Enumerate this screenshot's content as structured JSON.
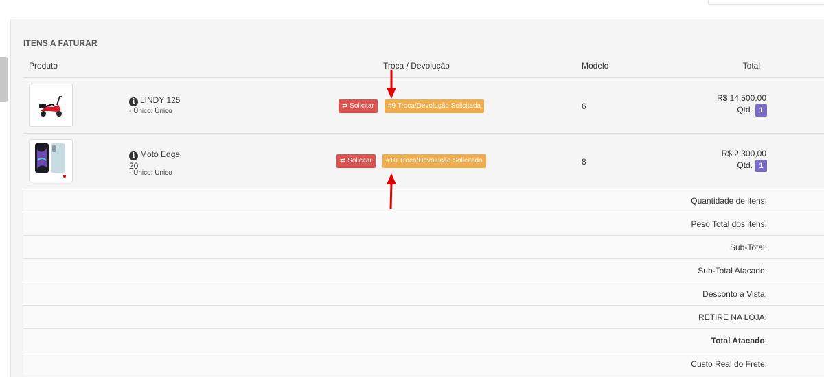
{
  "section": {
    "title": "ITENS A FATURAR"
  },
  "table": {
    "headers": {
      "produto": "Produto",
      "troca": "Troca / Devolução",
      "modelo": "Modelo",
      "total": "Total"
    },
    "rows": [
      {
        "name": "LINDY 125",
        "variant": "- Único: Único",
        "solicitar_label": "⇄ Solicitar",
        "troca_badge": "#9 Troca/Devolução Solicitada",
        "modelo": "6",
        "price": "R$ 14.500,00",
        "qtd_label": "Qtd.",
        "qtd": "1"
      },
      {
        "name_line1": "Moto Edge",
        "name_line2": "20",
        "variant": "- Único: Único",
        "solicitar_label": "⇄ Solicitar",
        "troca_badge": "#10 Troca/Devolução Solicitada",
        "modelo": "8",
        "price": "R$ 2.300,00",
        "qtd_label": "Qtd.",
        "qtd": "1"
      }
    ]
  },
  "summary": {
    "quantidade": "Quantidade de itens:",
    "peso": "Peso Total dos itens:",
    "subtotal": "Sub-Total:",
    "subtotal_atacado": "Sub-Total Atacado:",
    "desconto": "Desconto a Vista:",
    "retire": "RETIRE NA LOJA:",
    "total_atacado": "Total Atacado",
    "total_atacado_colon": ":",
    "frete": "Custo Real do Frete:"
  },
  "icons": {
    "info": "info-icon",
    "swap": "swap-icon",
    "annotation": "red-arrow-annotation"
  },
  "colors": {
    "solicitar": "#d9534f",
    "troca_badge": "#f0ad4e",
    "qtd_badge": "#7b6bc8",
    "annotation_arrow": "#e00000"
  }
}
